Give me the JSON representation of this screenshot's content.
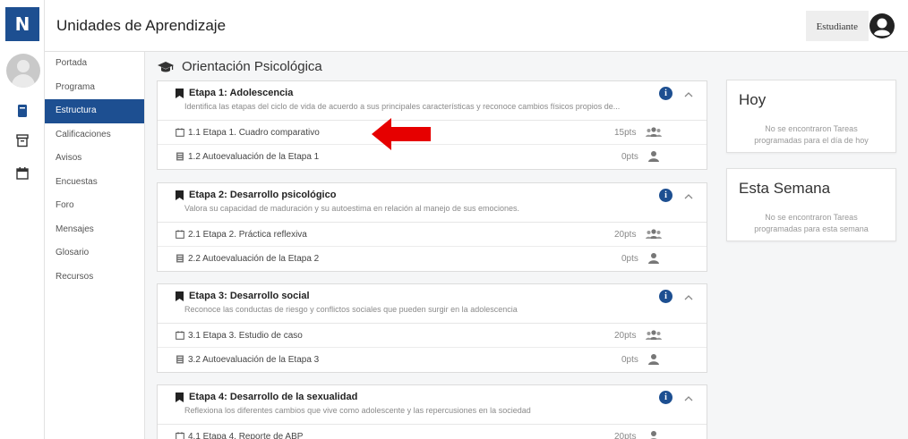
{
  "app": {
    "logo_letter": "N",
    "title": "Unidades de Aprendizaje",
    "user_name": "Estudiante"
  },
  "colors": {
    "brand": "#1d4f91",
    "arrow": "#e60000"
  },
  "rail_icons": [
    "book-icon",
    "archive-icon",
    "calendar-icon"
  ],
  "subnav": {
    "items": [
      {
        "label": "Portada"
      },
      {
        "label": "Programa"
      },
      {
        "label": "Estructura",
        "active": true
      },
      {
        "label": "Calificaciones"
      },
      {
        "label": "Avisos"
      },
      {
        "label": "Encuestas"
      },
      {
        "label": "Foro"
      },
      {
        "label": "Mensajes"
      },
      {
        "label": "Glosario"
      },
      {
        "label": "Recursos"
      }
    ]
  },
  "course": {
    "title": "Orientación Psicológica"
  },
  "etapas": [
    {
      "title": "Etapa 1: Adolescencia",
      "description": "Identifica las etapas del ciclo de vida de acuerdo a sus principales características y reconoce cambios físicos propios de...",
      "activities": [
        {
          "label": "1.1 Etapa 1. Cuadro comparativo",
          "points": "15pts",
          "type_icon": "group-icon",
          "icon": "assignment-icon"
        },
        {
          "label": "1.2 Autoevaluación de la Etapa 1",
          "points": "0pts",
          "type_icon": "user-icon",
          "icon": "quiz-icon"
        }
      ]
    },
    {
      "title": "Etapa 2: Desarrollo psicológico",
      "description": "Valora su capacidad de maduración y su autoestima en relación al manejo de sus emociones.",
      "activities": [
        {
          "label": "2.1 Etapa 2. Práctica reflexiva",
          "points": "20pts",
          "type_icon": "group-icon",
          "icon": "assignment-icon"
        },
        {
          "label": "2.2 Autoevaluación de la Etapa 2",
          "points": "0pts",
          "type_icon": "user-icon",
          "icon": "quiz-icon"
        }
      ]
    },
    {
      "title": "Etapa 3: Desarrollo social",
      "description": "Reconoce las conductas de riesgo y conflictos sociales que pueden surgir en la adolescencia",
      "activities": [
        {
          "label": "3.1 Etapa 3. Estudio de caso",
          "points": "20pts",
          "type_icon": "group-icon",
          "icon": "assignment-icon"
        },
        {
          "label": "3.2 Autoevaluación de la Etapa 3",
          "points": "0pts",
          "type_icon": "user-icon",
          "icon": "quiz-icon"
        }
      ]
    },
    {
      "title": "Etapa 4: Desarrollo de la sexualidad",
      "description": "Reflexiona los diferentes cambios que vive como adolescente y las repercusiones en la sociedad",
      "activities": [
        {
          "label": "4.1 Etapa 4. Reporte de ABP",
          "points": "20pts",
          "type_icon": "user-icon",
          "icon": "assignment-icon"
        }
      ]
    }
  ],
  "cards": {
    "today": {
      "title": "Hoy",
      "message": "No se encontraron Tareas programadas para el día de hoy"
    },
    "week": {
      "title": "Esta Semana",
      "message": "No se encontraron Tareas programadas para esta semana"
    }
  }
}
